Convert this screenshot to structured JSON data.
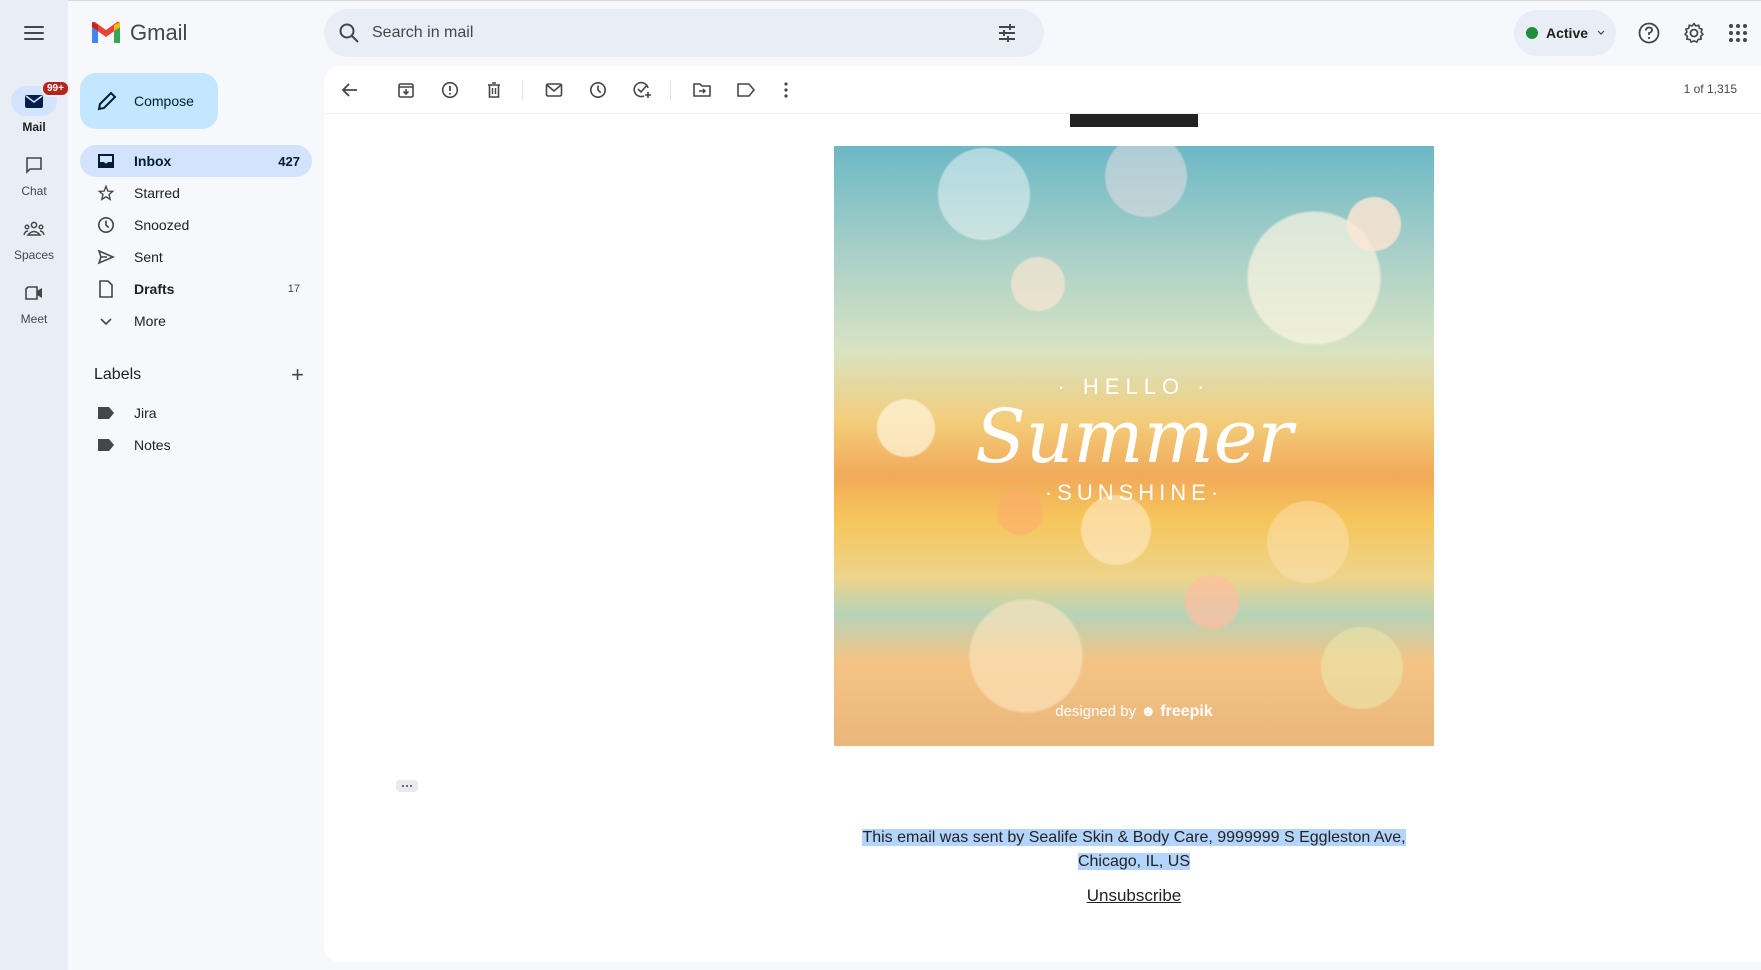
{
  "app": {
    "name": "Gmail"
  },
  "rail": {
    "items": [
      {
        "label": "Mail",
        "icon": "mail-icon",
        "badge": "99+",
        "active": true
      },
      {
        "label": "Chat",
        "icon": "chat-icon"
      },
      {
        "label": "Spaces",
        "icon": "spaces-icon"
      },
      {
        "label": "Meet",
        "icon": "meet-icon"
      }
    ]
  },
  "compose": {
    "label": "Compose"
  },
  "nav": {
    "items": [
      {
        "label": "Inbox",
        "count": "427",
        "icon": "inbox-icon",
        "active": true
      },
      {
        "label": "Starred",
        "count": "",
        "icon": "star-icon"
      },
      {
        "label": "Snoozed",
        "count": "",
        "icon": "clock-icon"
      },
      {
        "label": "Sent",
        "count": "",
        "icon": "send-icon"
      },
      {
        "label": "Drafts",
        "count": "17",
        "icon": "draft-icon"
      },
      {
        "label": "More",
        "count": "",
        "icon": "chevron-down-icon"
      }
    ]
  },
  "labels": {
    "title": "Labels",
    "add": "+",
    "items": [
      {
        "label": "Jira"
      },
      {
        "label": "Notes"
      }
    ]
  },
  "search": {
    "placeholder": "Search in mail",
    "value": ""
  },
  "status": {
    "label": "Active",
    "color": "#1e8e3e"
  },
  "toolbar": {
    "actions": [
      "Back",
      "Archive",
      "Report spam",
      "Delete",
      "Mark as unread",
      "Snooze",
      "Add to tasks",
      "Move to",
      "Labels",
      "More"
    ],
    "pager": "1 of 1,315"
  },
  "email": {
    "hero": {
      "line1": "· HELLO ·",
      "line2": "Summer",
      "line3": "·SUNSHINE·",
      "credit_prefix": "designed by",
      "credit_brand": "freepik"
    },
    "footer_line1": "This email was sent by Sealife Skin & Body Care, 9999999 S Eggleston Ave,",
    "footer_line2": "Chicago, IL, US",
    "unsubscribe": "Unsubscribe"
  },
  "colors": {
    "accent": "#c2e7ff",
    "active_nav": "#d3e3fd",
    "badge": "#b3261e"
  }
}
